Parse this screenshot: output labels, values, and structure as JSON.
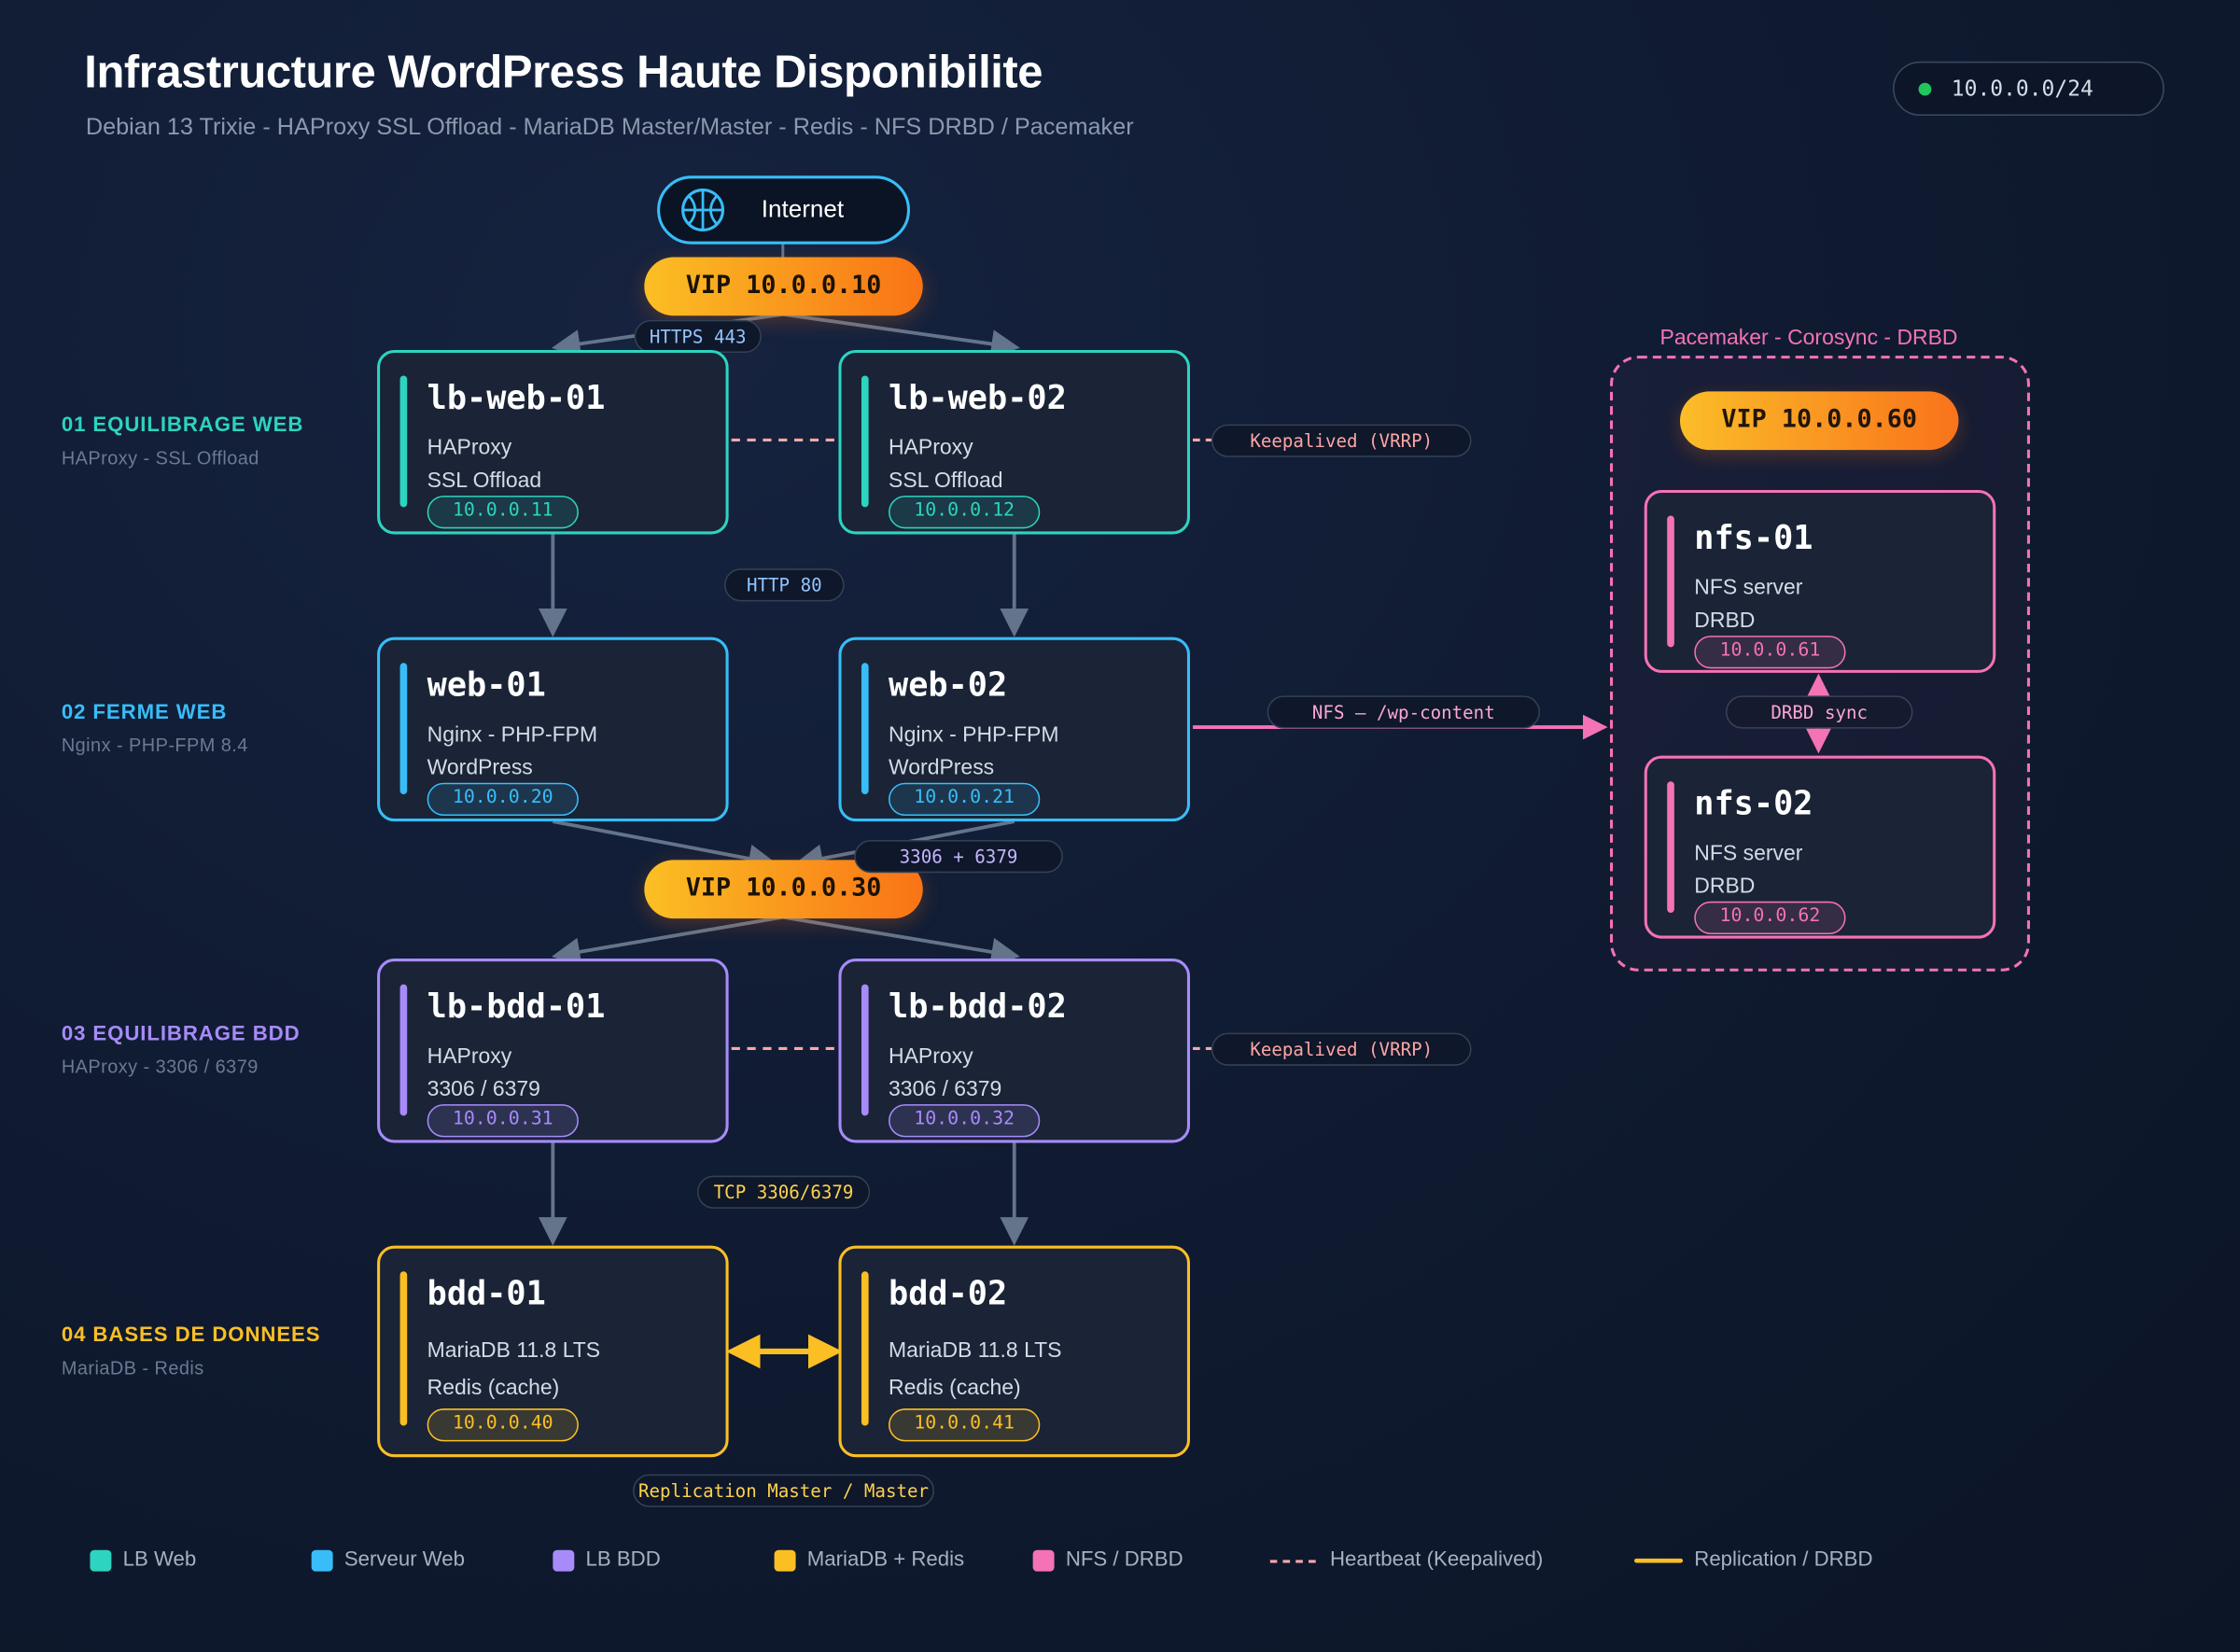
{
  "header": {
    "title": "Infrastructure WordPress Haute Disponibilite",
    "subtitle": "Debian 13 Trixie - HAProxy SSL Offload - MariaDB Master/Master - Redis - NFS DRBD / Pacemaker",
    "network": "10.0.0.0/24"
  },
  "internet": {
    "label": "Internet",
    "icon": "globe-icon"
  },
  "vips": {
    "web": "VIP 10.0.0.10",
    "bdd": "VIP 10.0.0.30",
    "nfs": "VIP 10.0.0.60"
  },
  "links": {
    "https": "HTTPS 443",
    "http": "HTTP 80",
    "db_ports": "3306 + 6379",
    "tcp": "TCP 3306/6379",
    "keepalived_web": "Keepalived (VRRP)",
    "keepalived_bdd": "Keepalived (VRRP)",
    "nfs_mount": "NFS – /wp-content",
    "drbd_sync": "DRBD sync",
    "replication": "Replication Master / Master"
  },
  "tiers": [
    {
      "title": "01 EQUILIBRAGE WEB",
      "sub": "HAProxy - SSL Offload"
    },
    {
      "title": "02 FERME WEB",
      "sub": "Nginx - PHP-FPM 8.4"
    },
    {
      "title": "03 EQUILIBRAGE BDD",
      "sub": "HAProxy - 3306 / 6379"
    },
    {
      "title": "04 BASES DE DONNEES",
      "sub": "MariaDB - Redis"
    }
  ],
  "nodes": {
    "lb_web_01": {
      "name": "lb-web-01",
      "l1": "HAProxy",
      "l2": "SSL Offload",
      "ip": "10.0.0.11"
    },
    "lb_web_02": {
      "name": "lb-web-02",
      "l1": "HAProxy",
      "l2": "SSL Offload",
      "ip": "10.0.0.12"
    },
    "web_01": {
      "name": "web-01",
      "l1": "Nginx - PHP-FPM",
      "l2": "WordPress",
      "ip": "10.0.0.20"
    },
    "web_02": {
      "name": "web-02",
      "l1": "Nginx - PHP-FPM",
      "l2": "WordPress",
      "ip": "10.0.0.21"
    },
    "lb_bdd_01": {
      "name": "lb-bdd-01",
      "l1": "HAProxy",
      "l2": "3306 / 6379",
      "ip": "10.0.0.31"
    },
    "lb_bdd_02": {
      "name": "lb-bdd-02",
      "l1": "HAProxy",
      "l2": "3306 / 6379",
      "ip": "10.0.0.32"
    },
    "bdd_01": {
      "name": "bdd-01",
      "l1": "MariaDB 11.8 LTS",
      "l2": "Redis (cache)",
      "ip": "10.0.0.40"
    },
    "bdd_02": {
      "name": "bdd-02",
      "l1": "MariaDB 11.8 LTS",
      "l2": "Redis (cache)",
      "ip": "10.0.0.41"
    },
    "nfs_01": {
      "name": "nfs-01",
      "l1": "NFS server",
      "l2": "DRBD",
      "ip": "10.0.0.61"
    },
    "nfs_02": {
      "name": "nfs-02",
      "l1": "NFS server",
      "l2": "DRBD",
      "ip": "10.0.0.62"
    }
  },
  "cluster": {
    "title": "Pacemaker - Corosync - DRBD"
  },
  "legend": [
    {
      "label": "LB Web",
      "color": "#2dd4bf"
    },
    {
      "label": "Serveur Web",
      "color": "#38bdf8"
    },
    {
      "label": "LB BDD",
      "color": "#a78bfa"
    },
    {
      "label": "MariaDB + Redis",
      "color": "#fbbf24"
    },
    {
      "label": "NFS / DRBD",
      "color": "#f472b6"
    },
    {
      "label": "Heartbeat (Keepalived)",
      "color": "#f9a8a8"
    },
    {
      "label": "Replication / DRBD",
      "color": "#fbbf24"
    }
  ],
  "colors": {
    "lb_web": "#2dd4bf",
    "web": "#38bdf8",
    "lb_bdd": "#a78bfa",
    "bdd": "#fbbf24",
    "nfs": "#f472b6",
    "wire": "#64748b"
  }
}
